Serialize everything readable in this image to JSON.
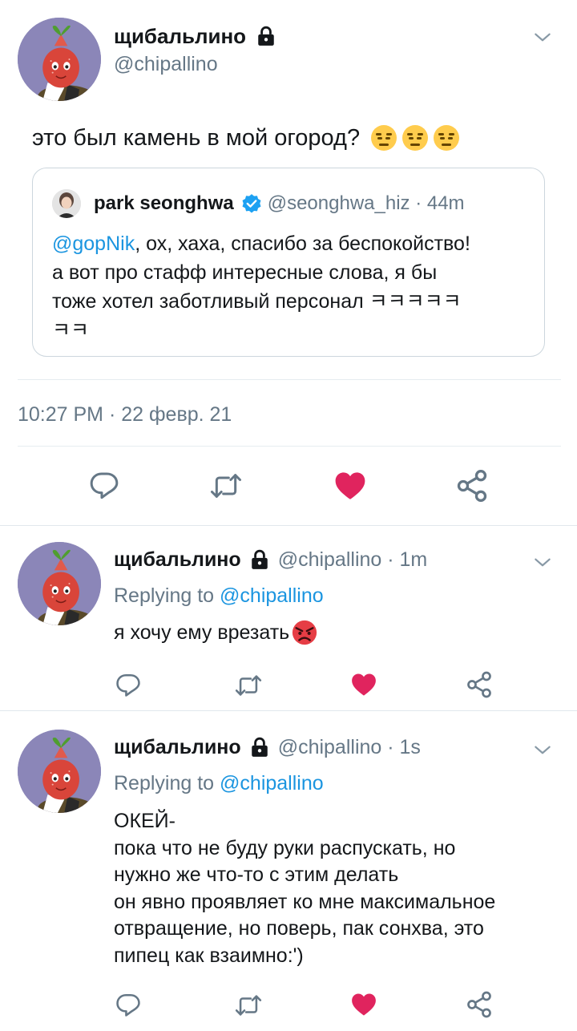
{
  "main_tweet": {
    "name": "щибальлино",
    "handle": "@chipallino",
    "text": "это был камень в мой огород?",
    "emoji": [
      "expressionless-face",
      "expressionless-face",
      "expressionless-face"
    ],
    "timestamp": "10:27 PM · 22 февр. 21",
    "quoted": {
      "name": "park seonghwa",
      "verified": true,
      "meta": "@seonghwa_hiz · 44m",
      "mention": "@gopNik",
      "line1_rest": ", ох, хаха, спасибо за беспокойство!",
      "line2": "а вот про стафф интересные слова, я бы",
      "line3": "тоже хотел заботливый персонал ㅋㅋㅋㅋㅋ",
      "line4": "ㅋㅋ"
    }
  },
  "replies": [
    {
      "name": "щибальлино",
      "meta": "@chipallino · 1m",
      "replying_prefix": "Replying to ",
      "replying_to": "@chipallino",
      "text": "я хочу ему врезать",
      "emoji": "angry-face"
    },
    {
      "name": "щибальлино",
      "meta": "@chipallino · 1s",
      "replying_prefix": "Replying to ",
      "replying_to": "@chipallino",
      "lines": [
        "ОКЕЙ-",
        "пока что не буду руки распускать, но",
        "нужно же что-то с этим делать",
        "он явно проявляет ко мне максимальное",
        "отвращение, но поверь, пак сонхва, это",
        "пипец как взаимно:')"
      ]
    }
  ],
  "colors": {
    "like_red": "#e0245e",
    "link_blue": "#1b95e0",
    "gray": "#657786",
    "verified_blue": "#1da1f2"
  }
}
